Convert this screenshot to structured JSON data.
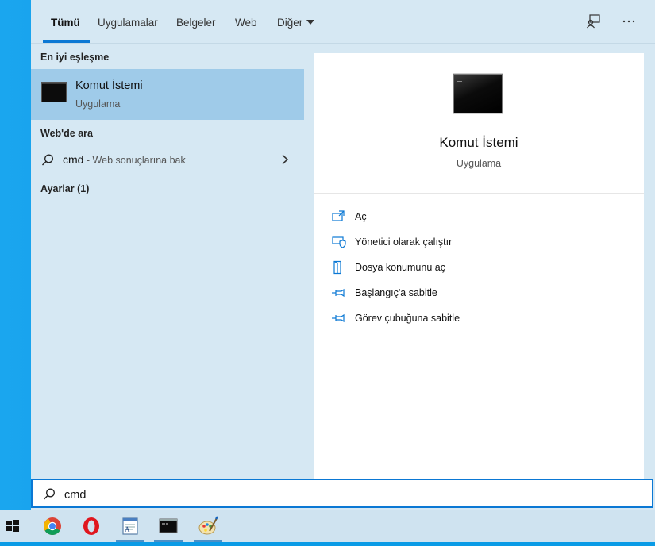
{
  "tabs": [
    {
      "label": "Tümü",
      "active": true
    },
    {
      "label": "Uygulamalar"
    },
    {
      "label": "Belgeler"
    },
    {
      "label": "Web"
    },
    {
      "label": "Diğer"
    }
  ],
  "top_icons": [
    "feedback-icon",
    "more-options-icon"
  ],
  "left": {
    "best_match_header": "En iyi eşleşme",
    "best_match": {
      "title": "Komut İstemi",
      "subtitle": "Uygulama"
    },
    "web_header": "Web'de ara",
    "web_result": {
      "query": "cmd",
      "hint": " - Web sonuçlarına bak"
    },
    "settings_header": "Ayarlar (1)"
  },
  "detail": {
    "title": "Komut İstemi",
    "subtitle": "Uygulama",
    "actions": [
      {
        "label": "Aç",
        "icon": "open-icon"
      },
      {
        "label": "Yönetici olarak çalıştır",
        "icon": "shield-admin-icon"
      },
      {
        "label": "Dosya konumunu aç",
        "icon": "file-location-icon"
      },
      {
        "label": "Başlangıç'a sabitle",
        "icon": "pin-start-icon"
      },
      {
        "label": "Görev çubuğuna sabitle",
        "icon": "pin-taskbar-icon"
      }
    ]
  },
  "search": {
    "value": "cmd"
  },
  "taskbar": [
    "windows-start-icon",
    "chrome-icon",
    "opera-icon",
    "wordpad-icon",
    "cmd-icon",
    "paint-icon"
  ],
  "colors": {
    "accent": "#0b78d4",
    "selected": "#9fcbe9",
    "panel": "#d6e8f3"
  }
}
